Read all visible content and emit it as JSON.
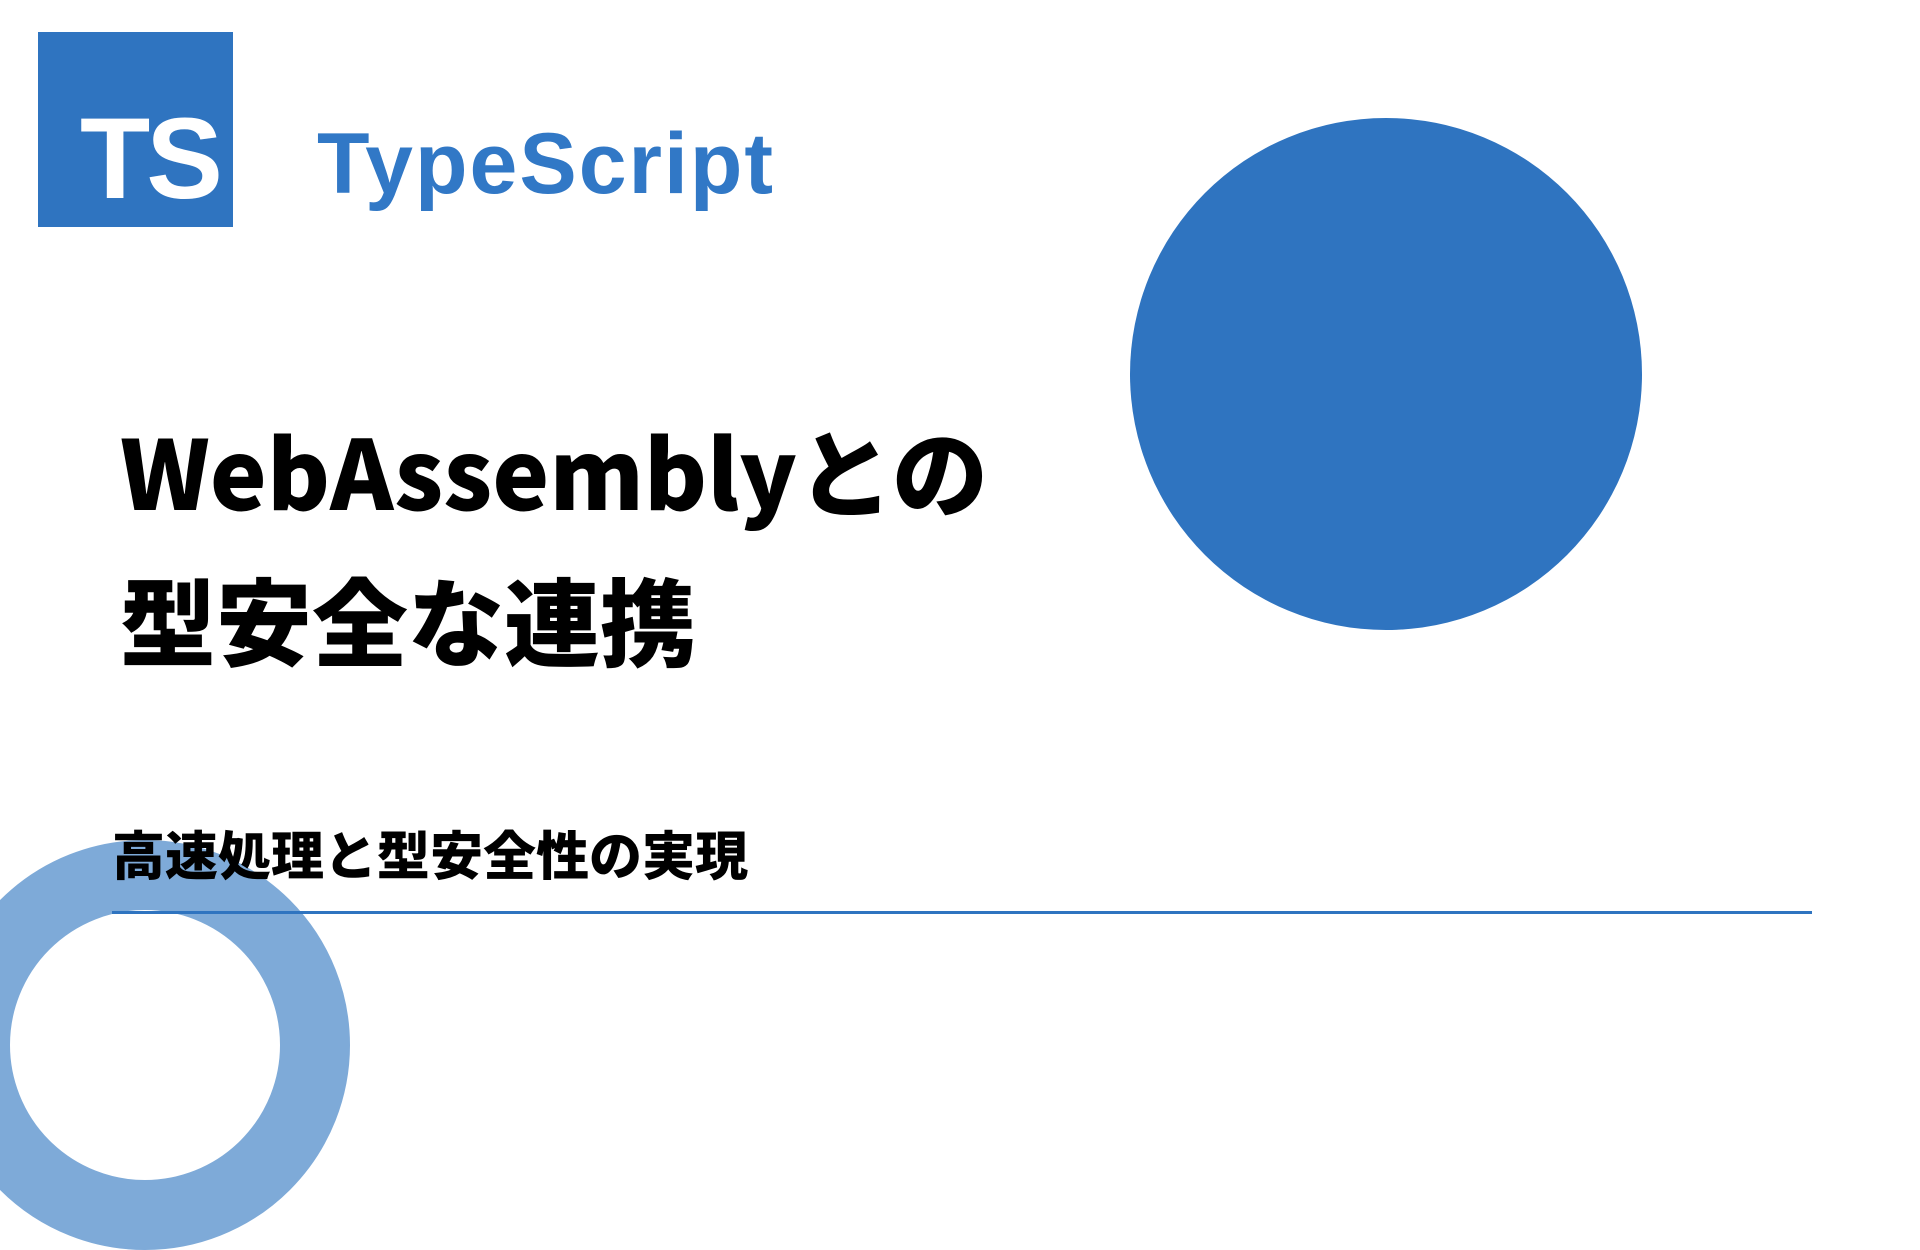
{
  "logo": {
    "text": "TS"
  },
  "brand": "TypeScript",
  "title_line1": "WebAssemblyとの",
  "title_line2": "型安全な連携",
  "subtitle": "高速処理と型安全性の実現",
  "colors": {
    "primary": "#2f74c0",
    "ring": "#7eaad8"
  }
}
